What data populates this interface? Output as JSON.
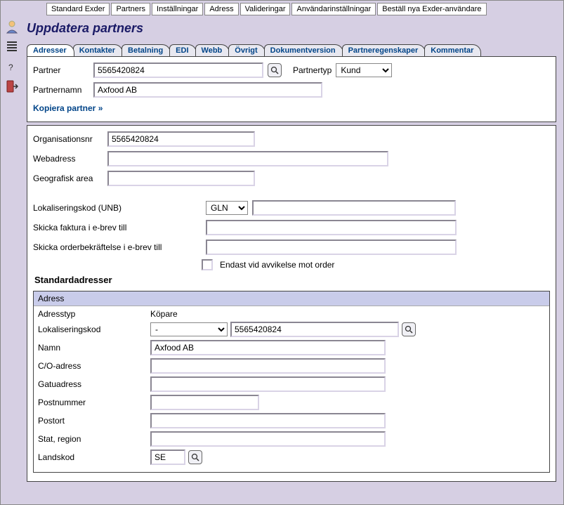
{
  "topTabs": [
    "Standard Exder",
    "Partners",
    "Inställningar",
    "Adress",
    "Valideringar",
    "Användarinställningar",
    "Beställ nya Exder-användare"
  ],
  "pageTitle": "Uppdatera partners",
  "subTabs": [
    "Adresser",
    "Kontakter",
    "Betalning",
    "EDI",
    "Webb",
    "Övrigt",
    "Dokumentversion",
    "Partneregenskaper",
    "Kommentar"
  ],
  "partner": {
    "label": "Partner",
    "value": "5565420824",
    "typeLabel": "Partnertyp",
    "typeValue": "Kund",
    "nameLabel": "Partnernamn",
    "nameValue": "Axfood AB",
    "copyLink": "Kopiera partner »"
  },
  "org": {
    "orgnrLabel": "Organisationsnr",
    "orgnrValue": "5565420824",
    "webLabel": "Webadress",
    "webValue": "",
    "geoLabel": "Geografisk area",
    "geoValue": "",
    "unbLabel": "Lokaliseringskod (UNB)",
    "unbType": "GLN",
    "unbValue": "",
    "invoiceEmailLabel": "Skicka faktura i e-brev till",
    "invoiceEmailValue": "",
    "orderconfEmailLabel": "Skicka orderbekräftelse i e-brev till",
    "orderconfEmailValue": "",
    "deviationOnlyLabel": "Endast vid avvikelse mot order"
  },
  "stdAddr": {
    "heading": "Standardadresser",
    "panelTitle": "Adress",
    "typeLabel": "Adresstyp",
    "typeValue": "Köpare",
    "locCodeLabel": "Lokaliseringskod",
    "locCodeType": "-",
    "locCodeValue": "5565420824",
    "nameLabel": "Namn",
    "nameValue": "Axfood AB",
    "coLabel": "C/O-adress",
    "coValue": "",
    "streetLabel": "Gatuadress",
    "streetValue": "",
    "zipLabel": "Postnummer",
    "zipValue": "",
    "cityLabel": "Postort",
    "cityValue": "",
    "stateLabel": "Stat, region",
    "stateValue": "",
    "countryLabel": "Landskod",
    "countryValue": "SE"
  }
}
